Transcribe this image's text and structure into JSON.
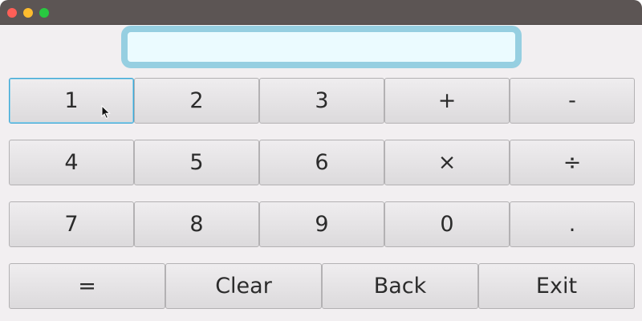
{
  "display": {
    "value": ""
  },
  "keys": {
    "one": "1",
    "two": "2",
    "three": "3",
    "plus": "+",
    "minus": "-",
    "four": "4",
    "five": "5",
    "six": "6",
    "multiply": "×",
    "divide": "÷",
    "seven": "7",
    "eight": "8",
    "nine": "9",
    "zero": "0",
    "decimal": ".",
    "equals": "=",
    "clear": "Clear",
    "back": "Back",
    "exit": "Exit"
  },
  "colors": {
    "titlebar": "#5c5554",
    "display_border": "#96cfe1",
    "display_bg": "#ebfbff",
    "focus_ring": "#3ea6d4"
  },
  "icons": {
    "close": "close-icon",
    "minimize": "minimize-icon",
    "maximize": "maximize-icon",
    "cursor": "mouse-pointer-icon"
  }
}
